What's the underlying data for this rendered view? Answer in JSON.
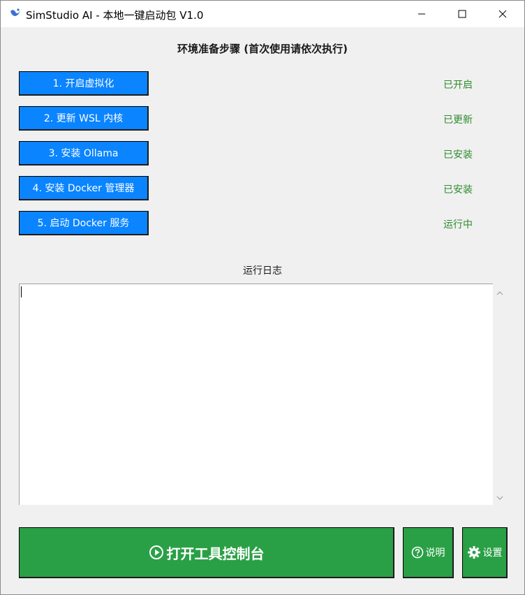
{
  "window": {
    "title": "SimStudio AI - 本地一键启动包 V1.0",
    "controls": {
      "minimize_icon": "minimize-icon",
      "maximize_icon": "maximize-icon",
      "close_icon": "close-icon"
    }
  },
  "setup": {
    "heading": "环境准备步骤 (首次使用请依次执行)",
    "steps": [
      {
        "label": "1. 开启虚拟化",
        "status": "已开启"
      },
      {
        "label": "2. 更新 WSL 内核",
        "status": "已更新"
      },
      {
        "label": "3. 安装 Ollama",
        "status": "已安装"
      },
      {
        "label": "4. 安装 Docker 管理器",
        "status": "已安装"
      },
      {
        "label": "5. 启动 Docker 服务",
        "status": "运行中"
      }
    ]
  },
  "log": {
    "heading": "运行日志",
    "content": ""
  },
  "actions": {
    "open_console_label": "打开工具控制台",
    "help_label": "说明",
    "settings_label": "设置"
  },
  "colors": {
    "step_button": "#0a84ff",
    "status_text": "#2e8b2e",
    "action_button": "#2aa046",
    "background": "#f0f0f0"
  }
}
